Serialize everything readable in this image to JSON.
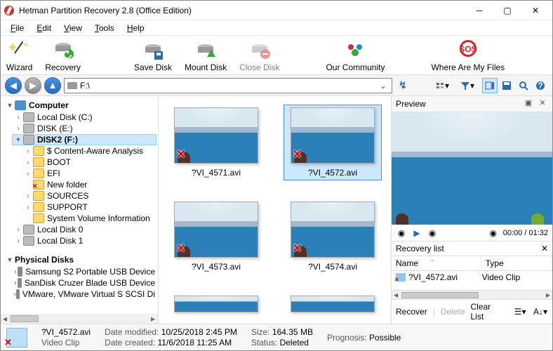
{
  "window": {
    "title": "Hetman Partition Recovery 2.8 (Office Edition)"
  },
  "menu": [
    {
      "l": "F",
      "rest": "ile"
    },
    {
      "l": "E",
      "rest": "dit"
    },
    {
      "l": "V",
      "rest": "iew"
    },
    {
      "l": "T",
      "rest": "ools"
    },
    {
      "l": "H",
      "rest": "elp"
    }
  ],
  "toolbar": {
    "wizard": "Wizard",
    "recovery": "Recovery",
    "save": "Save Disk",
    "mount": "Mount Disk",
    "close": "Close Disk",
    "community": "Our Community",
    "wheremf": "Where Are My Files"
  },
  "address": {
    "path": "F:\\"
  },
  "tree": {
    "computer": "Computer",
    "localc": "Local Disk (C:)",
    "diske": "DISK (E:)",
    "disk2f": "DISK2 (F:)",
    "caa": "$ Content-Aware Analysis",
    "boot": "BOOT",
    "efi": "EFI",
    "newfolder": "New folder",
    "sources": "SOURCES",
    "support": "SUPPORT",
    "svi": "System Volume Information",
    "ld0": "Local Disk 0",
    "ld1": "Local Disk 1",
    "physical": "Physical Disks",
    "dev1": "Samsung S2 Portable USB Device",
    "dev2": "SanDisk Cruzer Blade USB Device",
    "dev3": "VMware, VMware Virtual S SCSI Di"
  },
  "files": [
    {
      "name": "?VI_4571.avi"
    },
    {
      "name": "?VI_4572.avi",
      "selected": true
    },
    {
      "name": "?VI_4573.avi"
    },
    {
      "name": "?VI_4574.avi"
    }
  ],
  "preview": {
    "title": "Preview",
    "time": "00:00 / 01:32"
  },
  "recovery_list": {
    "title": "Recovery list",
    "col_name": "Name",
    "col_type": "Type",
    "items": [
      {
        "name": "?VI_4572.avi",
        "type": "Video Clip"
      }
    ],
    "recover": "Recover",
    "delete": "Delete",
    "clear": "Clear List"
  },
  "status": {
    "filename": "?VI_4572.avi",
    "filetype": "Video Clip",
    "dm_lbl": "Date modified:",
    "dm": "10/25/2018 2:45 PM",
    "dc_lbl": "Date created:",
    "dc": "11/6/2018 11:25 AM",
    "sz_lbl": "Size:",
    "sz": "164.35 MB",
    "st_lbl": "Status:",
    "st": "Deleted",
    "pg_lbl": "Prognosis:",
    "pg": "Possible"
  }
}
